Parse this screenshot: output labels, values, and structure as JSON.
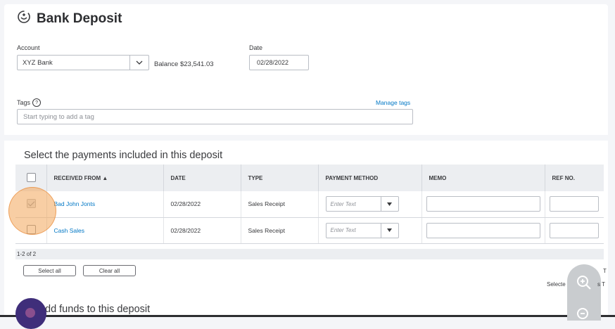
{
  "page": {
    "title": "Bank Deposit"
  },
  "account": {
    "label": "Account",
    "value": "XYZ Bank",
    "balance": "Balance $23,541.03"
  },
  "date": {
    "label": "Date",
    "value": "02/28/2022"
  },
  "tags": {
    "label": "Tags",
    "help": "?",
    "placeholder": "Start typing to add a tag",
    "manage_link": "Manage tags"
  },
  "payments": {
    "section_title": "Select the payments included in this deposit",
    "columns": [
      "RECEIVED FROM ▲",
      "DATE",
      "TYPE",
      "PAYMENT METHOD",
      "MEMO",
      "REF NO."
    ],
    "rows": [
      {
        "received_from": "Bad John Jonts",
        "date": "02/28/2022",
        "type": "Sales Receipt",
        "payment_method_placeholder": "Enter Text",
        "checked": true
      },
      {
        "received_from": "Cash Sales",
        "date": "02/28/2022",
        "type": "Sales Receipt",
        "payment_method_placeholder": "Enter Text",
        "checked": false
      }
    ],
    "pagination": "1-2 of 2",
    "select_all": "Select all",
    "clear_all": "Clear all"
  },
  "right_partial": {
    "t1": "T",
    "selected": "Selecte",
    "t2": "s T"
  },
  "add_funds": {
    "title": "dd funds to this deposit"
  },
  "colors": {
    "link": "#0077c5",
    "header_bg": "#eceef1",
    "highlight": "#f2a65a",
    "avatar": "#3f2e7a"
  },
  "icons": {
    "title_icon": "bank-deposit-icon",
    "zoom_in": "zoom-in-icon",
    "zoom_out": "zoom-out-icon"
  }
}
